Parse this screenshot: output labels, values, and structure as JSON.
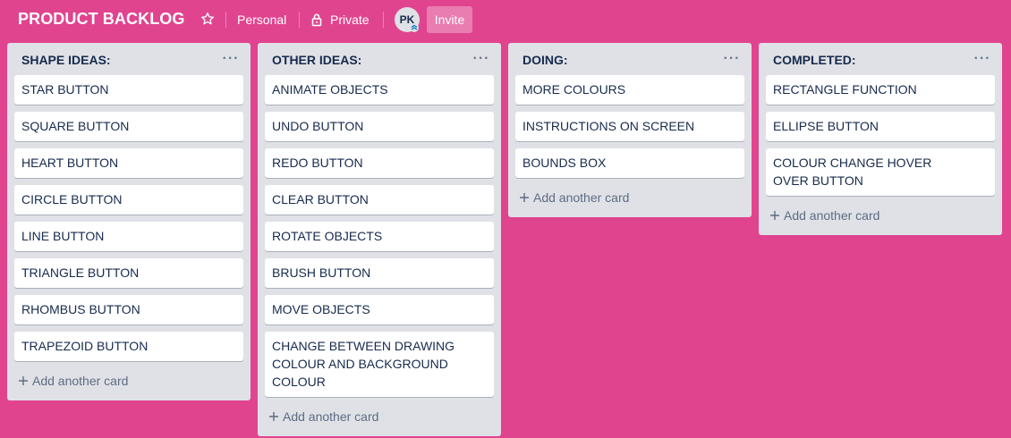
{
  "header": {
    "title": "PRODUCT BACKLOG",
    "star_icon": "star-icon",
    "team": "Personal",
    "visibility": "Private",
    "lock_icon": "lock-icon",
    "avatar_initials": "PK",
    "invite_label": "Invite"
  },
  "lists": [
    {
      "title": "SHAPE IDEAS:",
      "cards": [
        "STAR BUTTON",
        "SQUARE BUTTON",
        "HEART BUTTON",
        "CIRCLE BUTTON",
        "LINE BUTTON",
        "TRIANGLE BUTTON",
        "RHOMBUS BUTTON",
        "TRAPEZOID BUTTON"
      ],
      "add_label": "Add another card"
    },
    {
      "title": "OTHER IDEAS:",
      "cards": [
        "ANIMATE OBJECTS",
        "UNDO BUTTON",
        "REDO BUTTON",
        "CLEAR BUTTON",
        "ROTATE OBJECTS",
        "BRUSH BUTTON",
        "MOVE OBJECTS",
        "CHANGE BETWEEN DRAWING COLOUR AND BACKGROUND COLOUR"
      ],
      "add_label": "Add another card"
    },
    {
      "title": "DOING:",
      "cards": [
        "MORE COLOURS",
        "INSTRUCTIONS ON SCREEN",
        "BOUNDS BOX"
      ],
      "add_label": "Add another card"
    },
    {
      "title": "COMPLETED:",
      "cards": [
        "RECTANGLE FUNCTION",
        "ELLIPSE BUTTON",
        "COLOUR CHANGE HOVER OVER BUTTON"
      ],
      "add_label": "Add another card"
    }
  ],
  "colors": {
    "board_background": "#e0448f",
    "list_background": "#dfe1e6",
    "card_background": "#ffffff",
    "card_text": "#172b4d"
  }
}
